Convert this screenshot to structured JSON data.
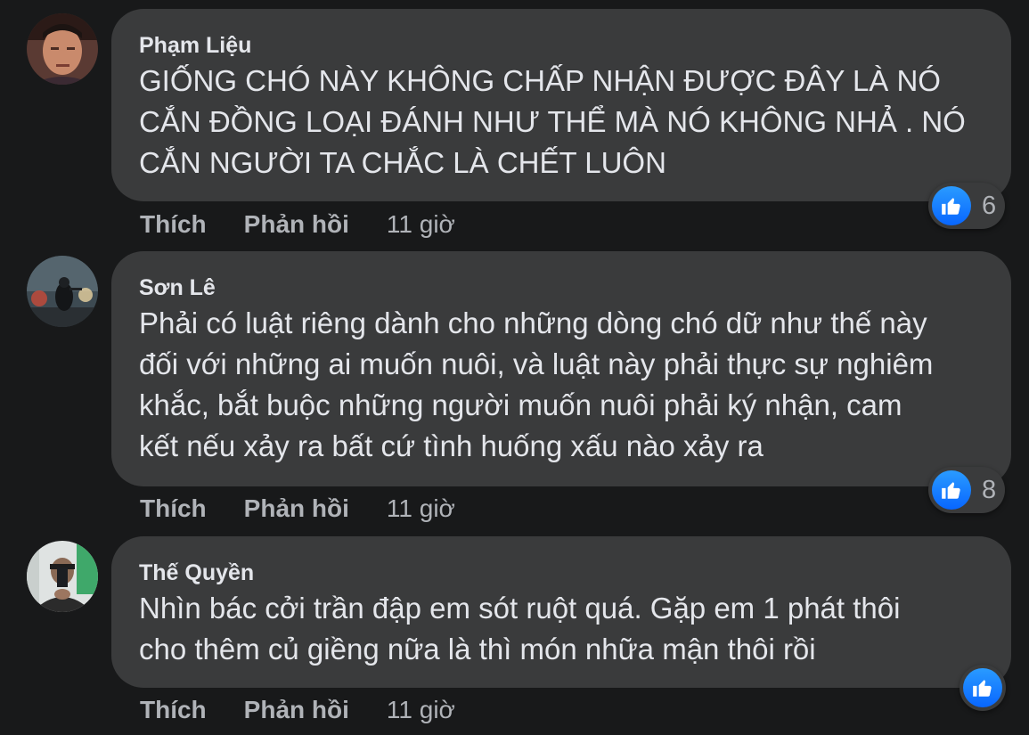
{
  "comments": [
    {
      "author": "Phạm Liệu",
      "lines": [
        "GIỐNG CHÓ NÀY KHÔNG CHẤP NHẬN ĐƯỢC ĐÂY LÀ NÓ",
        "CẮN ĐỒNG LOẠI ĐÁNH NHƯ THỂ MÀ NÓ KHÔNG NHẢ . NÓ",
        "CẮN NGƯỜI TA CHẮC LÀ CHẾT LUÔN"
      ],
      "reaction_count": "6",
      "like_label": "Thích",
      "reply_label": "Phản hồi",
      "time": "11 giờ"
    },
    {
      "author": "Sơn Lê",
      "lines": [
        "Phải có luật riêng dành cho những dòng chó dữ như thế này",
        "đối với những ai muốn nuôi, và luật này phải thực sự nghiêm",
        "khắc, bắt buộc những người muốn nuôi phải ký nhận, cam",
        "kết nếu xảy ra bất cứ tình huống xấu nào xảy ra"
      ],
      "reaction_count": "8",
      "like_label": "Thích",
      "reply_label": "Phản hồi",
      "time": "11 giờ"
    },
    {
      "author": "Thế Quyền",
      "lines": [
        "Nhìn bác cởi trần đập em sót ruột quá. Gặp em 1 phát thôi",
        "cho thêm củ giềng nữa là thì món nhữa mận thôi rồi"
      ],
      "like_label": "Thích",
      "reply_label": "Phản hồi",
      "time": "11 giờ"
    }
  ],
  "icons": {
    "reaction": "like-thumb-icon",
    "avatar": "avatar-photo"
  },
  "colors": {
    "background": "#18191a",
    "bubble": "#3a3b3c",
    "text": "#e4e6eb",
    "secondary_text": "#b0b3b8",
    "like_blue": "#0866ff"
  }
}
